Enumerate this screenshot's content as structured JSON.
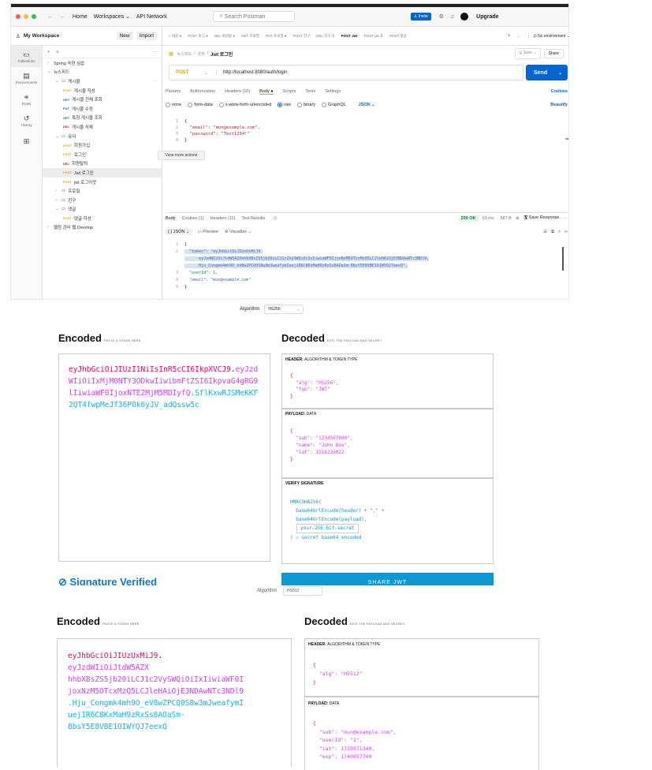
{
  "postman": {
    "nav": {
      "back": "←",
      "forward": "→",
      "home": "Home",
      "workspaces": "Workspaces ⌄",
      "api_network": "API Network",
      "search": "Search Postman",
      "invite": "Invite",
      "upgrade": "Upgrade"
    },
    "workspace": {
      "name": "My Workspace",
      "new_label": "New",
      "import_label": "Import"
    },
    "rail": [
      {
        "icon": "▭",
        "label": "Collections"
      },
      {
        "icon": "▤",
        "label": "Environments"
      },
      {
        "icon": "⚭",
        "label": "Flows"
      },
      {
        "icon": "↺",
        "label": "History"
      },
      {
        "icon": "⊞",
        "label": ""
      }
    ],
    "tree": [
      {
        "indent": 0,
        "arrow": "›",
        "method": "",
        "label": "Spring 숙련 심습"
      },
      {
        "indent": 0,
        "arrow": "⌄",
        "method": "",
        "label": "뉴스피드"
      },
      {
        "indent": 1,
        "arrow": "⌄",
        "method": "",
        "label": "게시물"
      },
      {
        "indent": 2,
        "arrow": "",
        "method": "POST",
        "label": "게시물 작성"
      },
      {
        "indent": 2,
        "arrow": "",
        "method": "GET",
        "label": "게시물 전체 조회"
      },
      {
        "indent": 2,
        "arrow": "",
        "method": "PUT",
        "label": "게시물 수정"
      },
      {
        "indent": 2,
        "arrow": "",
        "method": "GET",
        "label": "특정 게시물 조회"
      },
      {
        "indent": 2,
        "arrow": "",
        "method": "DEL",
        "label": "게시물 삭제"
      },
      {
        "indent": 1,
        "arrow": "⌄",
        "method": "",
        "label": "유저"
      },
      {
        "indent": 2,
        "arrow": "",
        "method": "POST",
        "label": "회원가입"
      },
      {
        "indent": 2,
        "arrow": "",
        "method": "POST",
        "label": "로그인"
      },
      {
        "indent": 2,
        "arrow": "",
        "method": "DEL",
        "label": "회원탈퇴"
      },
      {
        "indent": 2,
        "arrow": "",
        "method": "POST",
        "label": "Jwt 로그인"
      },
      {
        "indent": 2,
        "arrow": "",
        "method": "POST",
        "label": "jwt 로그아웃"
      },
      {
        "indent": 1,
        "arrow": "›",
        "method": "",
        "label": "프로필"
      },
      {
        "indent": 1,
        "arrow": "›",
        "method": "",
        "label": "친구"
      },
      {
        "indent": 1,
        "arrow": "⌄",
        "method": "",
        "label": "댓글"
      },
      {
        "indent": 2,
        "arrow": "",
        "method": "POST",
        "label": "댓글 작성"
      },
      {
        "indent": 0,
        "arrow": "›",
        "method": "",
        "label": "웹컴 관리 웹 Develop"
      }
    ],
    "tooltip": "View more actions",
    "tabs": [
      "< 회원 ●",
      "POST 로그 ●",
      "DEL 회원탈 ●",
      "GET 프로필",
      "PUT 프로필 ●",
      "POST 친구",
      "DEL 친구 삭",
      "POST Jwt",
      "POST jwt 로",
      "POST 댓글"
    ],
    "environment": "No environment",
    "breadcrumb": {
      "collection": "뉴스피드",
      "folder": "유저",
      "current": "Jwt 로그인"
    },
    "save_label": "Save",
    "share_label": "Share",
    "method": "POST",
    "url": "http://localhost:8080/auth/login",
    "send_label": "Send",
    "req_tabs": [
      "Params",
      "Authorization",
      "Headers (10)",
      "Body ●",
      "Scripts",
      "Tests",
      "Settings"
    ],
    "cookies_label": "Cookies",
    "body_types": [
      "none",
      "form-data",
      "x-www-form-urlencoded",
      "raw",
      "binary",
      "GraphQL"
    ],
    "body_format": "JSON ⌄",
    "beautify": "Beautify",
    "req_lines": [
      "{",
      "  \"email\": \"mun@example.com\",",
      "  \"password\": \"Test1234!\"",
      "}"
    ],
    "resp_tabs": [
      "Body",
      "Cookies (1)",
      "Headers (11)",
      "Test Results"
    ],
    "status": "200 OK",
    "time": "63 ms",
    "size": "587 B",
    "save_response": "Save Response",
    "resp_view": "{ } JSON ⌄",
    "preview": "▷ Preview",
    "visualize": "Visualize ⌄",
    "resp_lines": [
      "{",
      "  \"token\": \"eyJhbGciOiJIUzUxMiJ9.",
      "      eyJzdWIiOiJtdW5AZXhhbXBsZS5jb20iLCJ1c2VySWQiOiIxIiwiaWF0IjoxNzM5OTcxMzQ5LCJleHAiOjE3NDAwNTc3NDl9.",
      "      Hju_Congmk4mh9O_eV8wZPCQ0S8w3mJweafymIuej1R6C8KxMaH9zRxSs8AOaSm-8bsY5E8VBE1OIWYQJ7eexQ\",",
      "  \"userId\": 1,",
      "  \"email\": \"mun@example.com\"",
      "}"
    ]
  },
  "jwt1": {
    "algorithm_label": "Algorithm",
    "algorithm": "HS256",
    "encoded_title": "Encoded",
    "encoded_sub": "PASTE A TOKEN HERE",
    "token_header": "eyJhbGciOiJIUzI1NiIsInR5cCI6IkpXVCJ9",
    "token_payload": "eyJzdWIiOiIxMjM0NTY3ODkwIiwibmFtZSI6IkpvaG4gRG9lIiwiaWF0IjoxNTE2MjM5MDIyfQ",
    "token_sig": "SflKxwRJSMeKKF2QT4fwpMeJf36POk6yJV_adQssw5c",
    "decoded_title": "Decoded",
    "decoded_sub": "EDIT THE PAYLOAD AND SECRET",
    "header_title": "HEADER:",
    "header_sub": "ALGORITHM & TOKEN TYPE",
    "header_lines": [
      "{",
      "  \"alg\": \"HS256\",",
      "  \"typ\": \"JWT\"",
      "}"
    ],
    "payload_title": "PAYLOAD:",
    "payload_sub": "DATA",
    "payload_lines": [
      "{",
      "  \"sub\": \"1234567890\",",
      "  \"name\": \"John Doe\",",
      "  \"iat\": 1516239022",
      "}"
    ],
    "verify_title": "VERIFY SIGNATURE",
    "verify_lines": [
      "HMACSHA256(",
      "  base64UrlEncode(header) + \".\" +",
      "  base64UrlEncode(payload),"
    ],
    "secret": "your-256-bit-secret",
    "secret_tail": ") ☐ secret base64 encoded",
    "signature_verified": "Signature Verified",
    "share_label": "SHARE JWT"
  },
  "jwt2": {
    "algorithm_label": "Algorithm",
    "algorithm": "HS512",
    "encoded_title": "Encoded",
    "encoded_sub": "PASTE A TOKEN HERE",
    "token_lines": [
      {
        "c": "red",
        "t": "eyJhbGciOiJIUzUxMiJ9",
        "tail": "."
      },
      {
        "c": "pur",
        "t": "eyJzdWIiOiJtdW5AZX"
      },
      {
        "c": "pur",
        "t": "hhbXBsZS5jb20iLCJ1c2VySWQiOiIxIiwiaWF0I"
      },
      {
        "c": "pur",
        "t": "joxNzM5OTcxMzQ5LCJleHAiOjE3NDAwNTc3NDl9"
      },
      {
        "c": "cyn",
        "t": ".Hju_Congmk4mh9O_eV8wZPCQ0S8w3mJweafymI"
      },
      {
        "c": "cyn",
        "t": "uej1R6C8KxMaH9zRxSs8AOaSm-"
      },
      {
        "c": "cyn",
        "t": "8bsY5E8VBE1OIWYQJ7eexQ"
      }
    ],
    "decoded_title": "Decoded",
    "decoded_sub": "EDIT THE PAYLOAD AND SECRET",
    "header_title": "HEADER:",
    "header_sub": "ALGORITHM & TOKEN TYPE",
    "header_lines": [
      "{",
      "  \"alg\": \"HS512\"",
      "}"
    ],
    "payload_title": "PAYLOAD:",
    "payload_sub": "DATA",
    "payload_lines": [
      "{",
      "  \"sub\": \"mun@example.com\",",
      "  \"userId\": \"1\",",
      "  \"iat\": 1739971349,",
      "  \"exp\": 1740057749"
    ]
  }
}
